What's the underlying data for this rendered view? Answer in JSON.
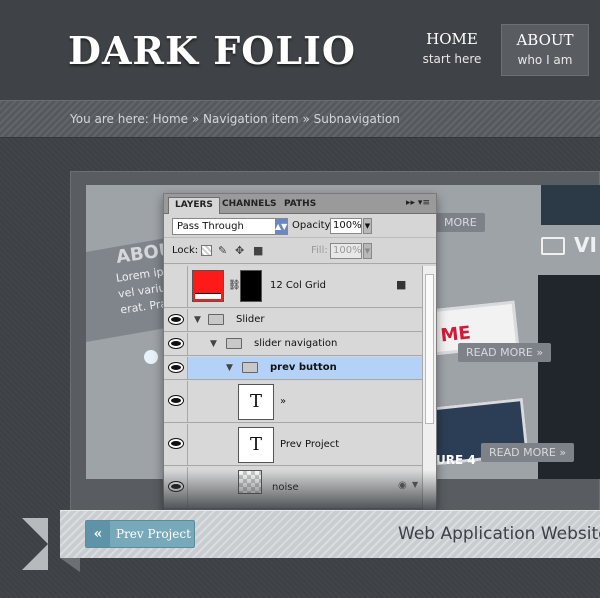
{
  "header": {
    "logo": "DARK FOLIO",
    "nav": [
      {
        "title": "HOME",
        "subtitle": "start here"
      },
      {
        "title": "ABOUT",
        "subtitle": "who I am"
      }
    ]
  },
  "breadcrumb": {
    "text": "You are here: Home » Navigation item » Subnavigation"
  },
  "slide": {
    "about_text": "ABOU",
    "lorem_lines": [
      "Lorem ip",
      "vel varius",
      "erat. Pra"
    ],
    "vi_text": "VI",
    "tag_top": "MORE",
    "read_more_1": "READ MORE »",
    "read_more_2": "READ MORE »",
    "thumb_text": "ME",
    "ure_text": "URE 4"
  },
  "layers_panel": {
    "tabs": [
      "LAYERS",
      "CHANNELS",
      "PATHS"
    ],
    "tab_menu_glyph": "▸▸ ▾≡",
    "blend_mode": "Pass Through",
    "opacity_label": "Opacity:",
    "opacity_value": "100%",
    "lock_label": "Lock:",
    "fill_label": "Fill:",
    "fill_value": "100%",
    "layers": [
      {
        "name": "12 Col Grid",
        "type": "thumb-color"
      },
      {
        "name": "Slider",
        "type": "group"
      },
      {
        "name": "slider navigation",
        "type": "group"
      },
      {
        "name": "prev button",
        "type": "group",
        "selected": true
      },
      {
        "name": "»",
        "type": "text",
        "thumb": "T"
      },
      {
        "name": "Prev Project",
        "type": "text",
        "thumb": "T"
      },
      {
        "name": "noise",
        "type": "thumb-noise"
      }
    ]
  },
  "bottom": {
    "prev_chevron": "«",
    "prev_label": "Prev Project",
    "project_title": "Web Application Website"
  },
  "colors": {
    "accent_button": "#78a9bb",
    "selected_layer": "#b4d2f8",
    "grid_red": "#ff1a1a"
  }
}
